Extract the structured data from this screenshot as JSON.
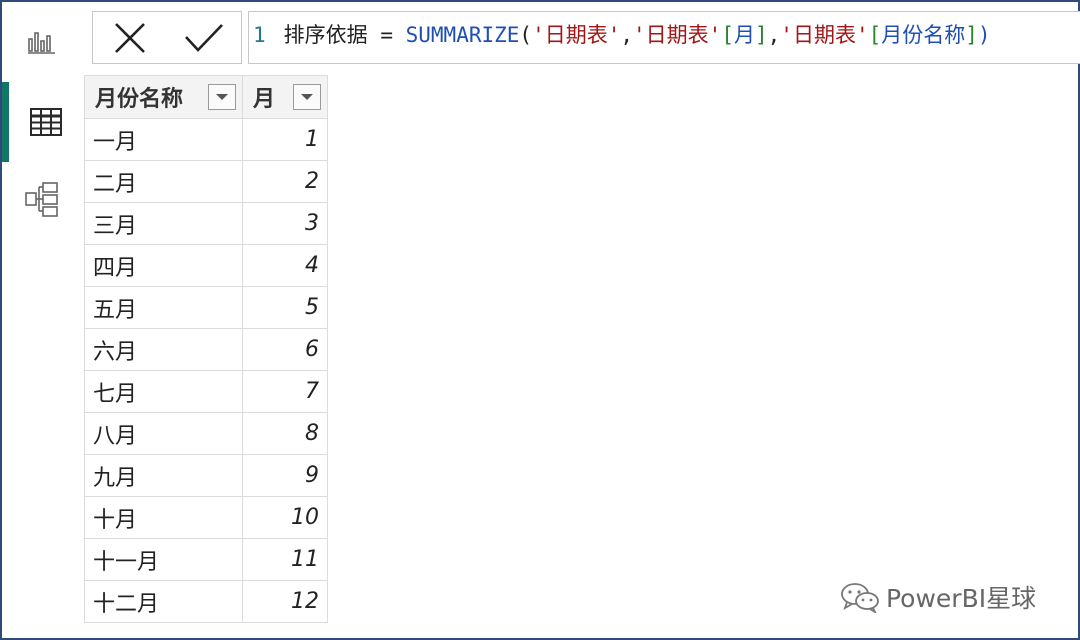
{
  "formula": {
    "line_number": "1",
    "name": "排序依据",
    "equals": "=",
    "function": "SUMMARIZE",
    "open_paren": "(",
    "table_ref_1": "'日期表'",
    "comma1": ",",
    "table_ref_2": "'日期表'",
    "bracket_open_2": "[",
    "column_2": "月",
    "bracket_close_2": "]",
    "comma2": ",",
    "table_ref_3": "'日期表'",
    "bracket_open_3": "[",
    "column_3": "月份名称",
    "bracket_close_3": "]",
    "close_paren": ")"
  },
  "table": {
    "headers": [
      "月份名称",
      "月"
    ],
    "rows": [
      [
        "一月",
        "1"
      ],
      [
        "二月",
        "2"
      ],
      [
        "三月",
        "3"
      ],
      [
        "四月",
        "4"
      ],
      [
        "五月",
        "5"
      ],
      [
        "六月",
        "6"
      ],
      [
        "七月",
        "7"
      ],
      [
        "八月",
        "8"
      ],
      [
        "九月",
        "9"
      ],
      [
        "十月",
        "10"
      ],
      [
        "十一月",
        "11"
      ],
      [
        "十二月",
        "12"
      ]
    ]
  },
  "watermark": {
    "text": "PowerBI星球"
  },
  "colors": {
    "accent": "#117865",
    "frame": "#2e4b7a",
    "keyword": "#1f4fb4",
    "string": "#a31515",
    "bracket": "#29862f"
  },
  "icons": {
    "rail": [
      "report-view-icon",
      "table-view-icon",
      "model-view-icon"
    ],
    "formula_buttons": [
      "cancel-icon",
      "commit-icon"
    ]
  }
}
